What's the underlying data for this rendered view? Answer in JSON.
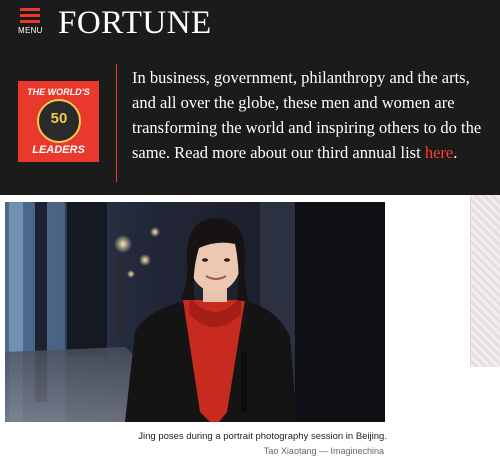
{
  "header": {
    "menu_label": "MENU",
    "logo": "FORTUNE"
  },
  "banner": {
    "badge_line1": "THE WORLD'S",
    "badge_number": "50",
    "badge_line2": "LEADERS",
    "text": "In business, government, philanthropy and the arts, and all over the globe, these men and women are transforming the world and inspiring others to do the same. Read more about our third annual list ",
    "link_text": "here",
    "trailing": "."
  },
  "photo": {
    "caption": "Jing poses during a portrait photography session in Beijing.",
    "credit": "Tao Xiaotang — Imaginechina"
  },
  "colors": {
    "accent": "#e8392c",
    "header_bg": "#1b1b1b"
  }
}
